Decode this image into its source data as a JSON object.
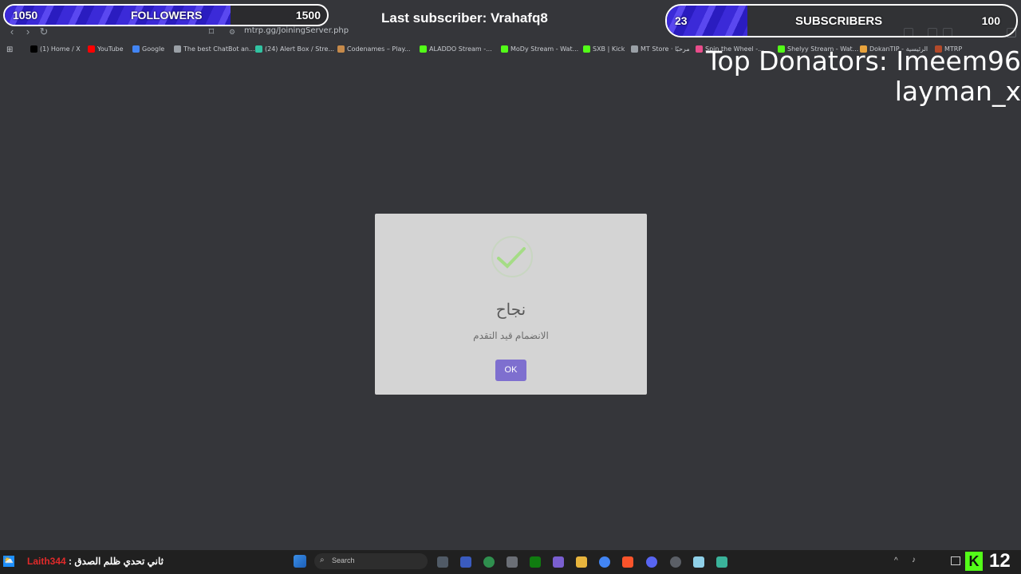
{
  "browser": {
    "url": "mtrp.gg/JoiningServer.php",
    "bookmarks": [
      {
        "label": "(1) Home / X",
        "icon": "x-icon",
        "color": "#000000"
      },
      {
        "label": "YouTube",
        "icon": "youtube-icon",
        "color": "#ff0000"
      },
      {
        "label": "Google",
        "icon": "google-icon",
        "color": "#4285f4"
      },
      {
        "label": "The best ChatBot an...",
        "icon": "chatbot-icon",
        "color": "#9aa0a6"
      },
      {
        "label": "(24) Alert Box / Stre...",
        "icon": "streamlabs-icon",
        "color": "#31c3a2"
      },
      {
        "label": "Codenames – Play...",
        "icon": "codenames-icon",
        "color": "#c68a4a"
      },
      {
        "label": "ALADDO Stream -...",
        "icon": "kick-icon",
        "color": "#53fc18"
      },
      {
        "label": "MoDy Stream - Wat...",
        "icon": "kick-icon",
        "color": "#53fc18"
      },
      {
        "label": "SXB | Kick",
        "icon": "kick-icon",
        "color": "#53fc18"
      },
      {
        "label": "MT Store · مرحبًا",
        "icon": "globe-icon",
        "color": "#9aa0a6"
      },
      {
        "label": "Spin the Wheel -...",
        "icon": "wheel-icon",
        "color": "#e94d8b"
      },
      {
        "label": "Shelyy Stream - Wat...",
        "icon": "kick-icon",
        "color": "#53fc18"
      },
      {
        "label": "DokanTIP - الرئيسية",
        "icon": "dokan-icon",
        "color": "#e8a33d"
      },
      {
        "label": "MTRP",
        "icon": "mtrp-icon",
        "color": "#b34a2a"
      }
    ]
  },
  "overlay": {
    "followers": {
      "current": "1050",
      "label": "FOLLOWERS",
      "goal": "1500",
      "progress": 0.7
    },
    "subscribers": {
      "current": "23",
      "label": "SUBSCRIBERS",
      "goal": "100",
      "progress": 0.23
    },
    "last_subscriber": "Last subscriber: Vrahafq8",
    "top_donators_line1": "Top Donators: Imeem96",
    "top_donators_line2": "layman_x"
  },
  "modal": {
    "icon": "checkmark-icon",
    "title": "نجاح",
    "message": "الانضمام قيد التقدم",
    "ok_label": "OK"
  },
  "taskbar": {
    "ticker_name": "Laith344",
    "ticker_sep": " : ",
    "ticker_text": "ثاني تحدي ظلم الصدق",
    "search_placeholder": "Search",
    "kick_letter": "K",
    "kick_count": "12"
  },
  "colors": {
    "accent": "#7e6fcf",
    "kick": "#53fc18",
    "bar_fill": "#3b2ad8"
  }
}
